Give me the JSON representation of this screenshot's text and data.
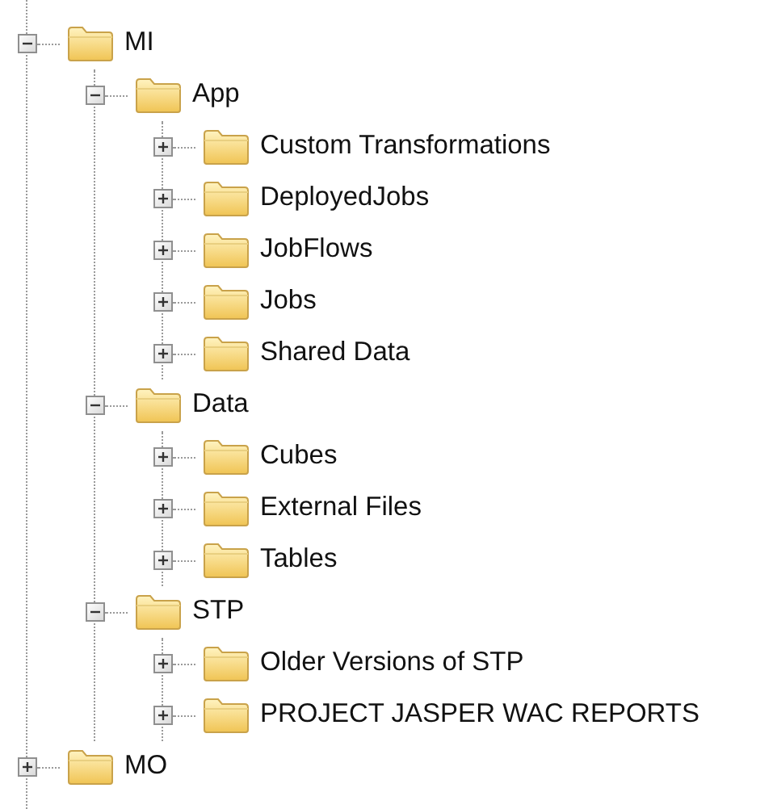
{
  "tree": [
    {
      "label": "MI",
      "expanded": true,
      "children": [
        {
          "label": "App",
          "expanded": true,
          "children": [
            {
              "label": "Custom Transformations",
              "expanded": false
            },
            {
              "label": "DeployedJobs",
              "expanded": false
            },
            {
              "label": "JobFlows",
              "expanded": false
            },
            {
              "label": "Jobs",
              "expanded": false
            },
            {
              "label": "Shared Data",
              "expanded": false
            }
          ]
        },
        {
          "label": "Data",
          "expanded": true,
          "children": [
            {
              "label": "Cubes",
              "expanded": false
            },
            {
              "label": "External Files",
              "expanded": false
            },
            {
              "label": "Tables",
              "expanded": false
            }
          ]
        },
        {
          "label": "STP",
          "expanded": true,
          "children": [
            {
              "label": "Older Versions of STP",
              "expanded": false
            },
            {
              "label": "PROJECT JASPER WAC REPORTS",
              "expanded": false
            }
          ]
        }
      ]
    },
    {
      "label": "MO",
      "expanded": false
    }
  ]
}
